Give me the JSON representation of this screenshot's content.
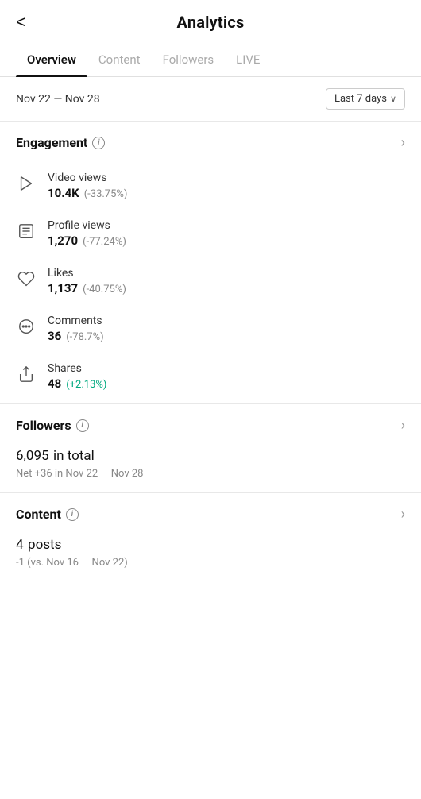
{
  "header": {
    "back_label": "<",
    "title": "Analytics"
  },
  "tabs": [
    {
      "id": "overview",
      "label": "Overview",
      "active": true
    },
    {
      "id": "content",
      "label": "Content",
      "active": false
    },
    {
      "id": "followers",
      "label": "Followers",
      "active": false
    },
    {
      "id": "live",
      "label": "LIVE",
      "active": false
    }
  ],
  "date": {
    "range": "Nov 22 — Nov 28",
    "dropdown_label": "Last 7 days"
  },
  "engagement": {
    "section_title": "Engagement",
    "metrics": [
      {
        "id": "video-views",
        "name": "Video views",
        "value": "10.4K",
        "change": "(-33.75%)",
        "positive": false
      },
      {
        "id": "profile-views",
        "name": "Profile views",
        "value": "1,270",
        "change": "(-77.24%)",
        "positive": false
      },
      {
        "id": "likes",
        "name": "Likes",
        "value": "1,137",
        "change": "(-40.75%)",
        "positive": false
      },
      {
        "id": "comments",
        "name": "Comments",
        "value": "36",
        "change": "(-78.7%)",
        "positive": false
      },
      {
        "id": "shares",
        "name": "Shares",
        "value": "48",
        "change": "(+2.13%)",
        "positive": true
      }
    ]
  },
  "followers": {
    "section_title": "Followers",
    "total_value": "6,095",
    "total_label": "in total",
    "net_text": "Net +36 in Nov 22 — Nov 28"
  },
  "content": {
    "section_title": "Content",
    "posts_value": "4",
    "posts_label": "posts",
    "compare_text": "-1 (vs. Nov 16 — Nov 22)"
  },
  "info_icon_label": "i",
  "chevron_label": "›"
}
